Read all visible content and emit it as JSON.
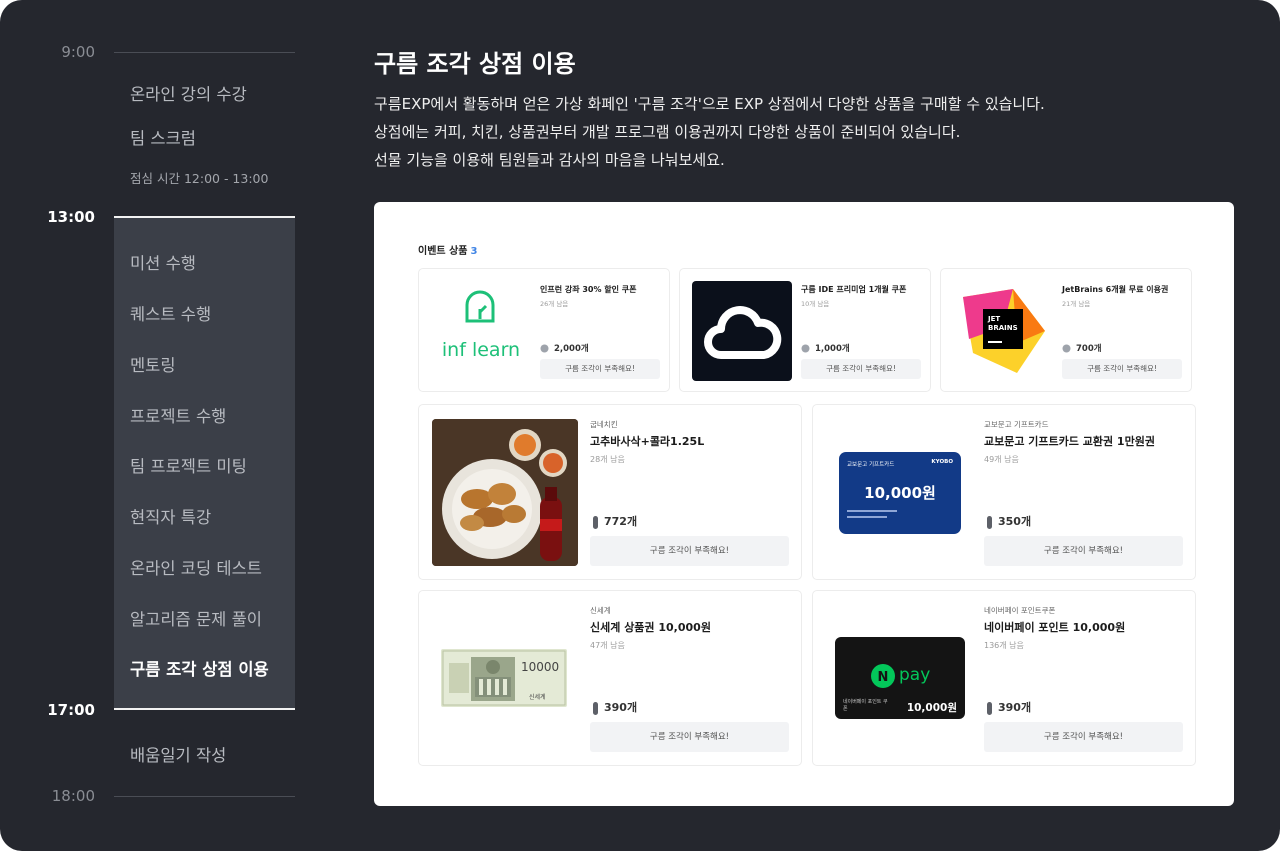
{
  "timeline": {
    "times": [
      "9:00",
      "13:00",
      "17:00",
      "18:00"
    ],
    "morning_items": [
      "온라인 강의 수강",
      "팀 스크럼"
    ],
    "lunch": "점심 시간 12:00 - 13:00",
    "afternoon_items": [
      "미션 수행",
      "퀘스트 수행",
      "멘토링",
      "프로젝트 수행",
      "팀 프로젝트 미팅",
      "현직자 특강",
      "온라인 코딩 테스트",
      "알고리즘 문제 풀이",
      "구름 조각 상점 이용"
    ],
    "evening_items": [
      "배움일기 작성"
    ],
    "active_item": "구름 조각 상점 이용"
  },
  "header": {
    "title": "구름 조각 상점 이용",
    "desc": [
      "구름EXP에서 활동하며 얻은 가상 화페인 '구름 조각'으로 EXP 상점에서 다양한 상품을 구매할 수 있습니다.",
      "상점에는 커피, 치킨, 상품권부터 개발 프로그램 이용권까지 다양한 상품이 준비되어 있습니다.",
      "선물 기능을 이용해 팀원들과 감사의 마음을 나눠보세요."
    ]
  },
  "store": {
    "section_title": "이벤트 상품",
    "section_count": "3",
    "event_items": [
      {
        "name": "인프런 강좌 30% 할인 쿠폰",
        "left": "26개 남음",
        "price": "2,000개",
        "button": "구름 조각이 부족해요!",
        "logo_text": "inf learn"
      },
      {
        "name": "구름 IDE 프리미엄 1개월 쿠폰",
        "left": "10개 남음",
        "price": "1,000개",
        "button": "구름 조각이 부족해요!"
      },
      {
        "name": "JetBrains 6개월 무료 이용권",
        "left": "21개 남음",
        "price": "700개",
        "button": "구름 조각이 부족해요!",
        "logo_text": "JET BRAINS"
      }
    ],
    "products": [
      {
        "brand": "굽네치킨",
        "name": "고추바사삭+콜라1.25L",
        "left": "28개 남음",
        "price": "772개",
        "button": "구름 조각이 부족해요!"
      },
      {
        "brand": "교보문고 기프트카드",
        "name": "교보문고 기프트카드 교환권 1만원권",
        "left": "49개 남음",
        "price": "350개",
        "button": "구름 조각이 부족해요!",
        "card_label": "교보문고 기프트카드",
        "card_logo": "KYOBO",
        "card_amount": "10,000원"
      },
      {
        "brand": "신세계",
        "name": "신세계 상품권 10,000원",
        "left": "47개 남음",
        "price": "390개",
        "button": "구름 조각이 부족해요!",
        "voucher_value": "10000",
        "voucher_brand": "신세계"
      },
      {
        "brand": "네이버페이 포인트쿠폰",
        "name": "네이버페이 포인트 10,000원",
        "left": "136개 남음",
        "price": "390개",
        "button": "구름 조각이 부족해요!",
        "card_logo": "pay",
        "card_amount": "10,000원",
        "card_small": "네이버페이 포인트 쿠폰"
      }
    ]
  },
  "colors": {
    "background": "#25272e",
    "highlight_block": "#3b3f48",
    "accent_count": "#3f84e5",
    "inflearn_green": "#1dc078",
    "kyobo_blue": "#123a87",
    "npay_green": "#03c75a"
  }
}
